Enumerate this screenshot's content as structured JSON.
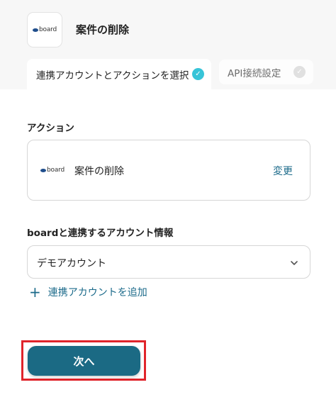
{
  "header": {
    "logo_text": "board",
    "title": "案件の削除"
  },
  "tabs": [
    {
      "label": "連携アカウントとアクションを選択",
      "active": true
    },
    {
      "label": "API接続設定",
      "active": false
    }
  ],
  "action_section": {
    "label": "アクション",
    "app_logo_text": "board",
    "action_name": "案件の削除",
    "change_label": "変更"
  },
  "account_section": {
    "label": "boardと連携するアカウント情報",
    "selected_account": "デモアカウント",
    "add_label": "連携アカウントを追加"
  },
  "next_button": {
    "label": "次へ"
  },
  "colors": {
    "accent": "#1b6a84",
    "check_active": "#37c4d8",
    "highlight": "#e0242b"
  }
}
